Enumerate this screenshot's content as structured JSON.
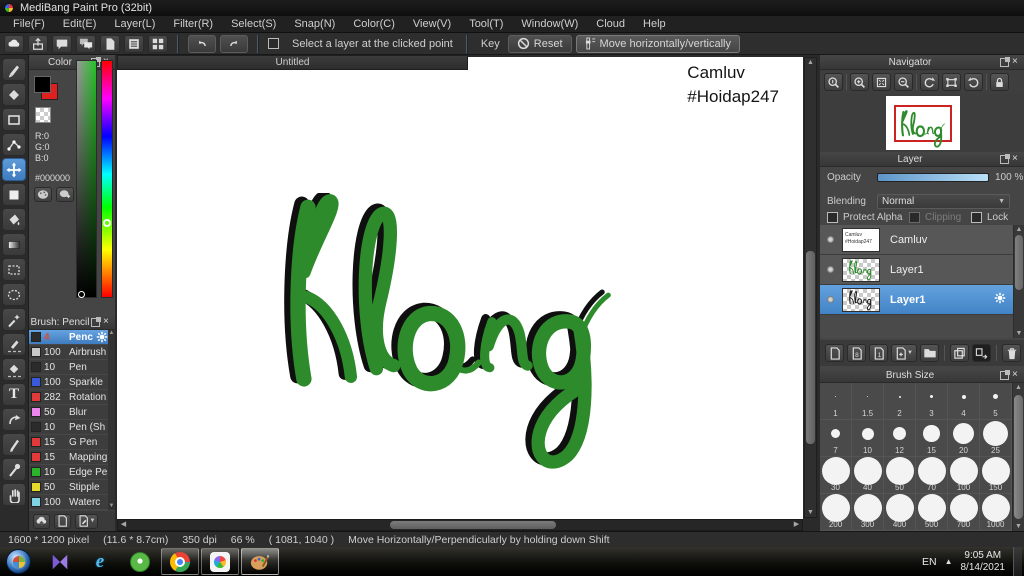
{
  "window": {
    "title": "MediBang Paint Pro (32bit)"
  },
  "menu": {
    "items": [
      "File(F)",
      "Edit(E)",
      "Layer(L)",
      "Filter(R)",
      "Select(S)",
      "Snap(N)",
      "Color(C)",
      "View(V)",
      "Tool(T)",
      "Window(W)",
      "Cloud",
      "Help"
    ]
  },
  "toolbar": {
    "select_layer_label": "Select a layer at the clicked point",
    "key_label": "Key",
    "reset_label": "Reset",
    "move_label": "Move horizontally/vertically"
  },
  "color_panel": {
    "title": "Color",
    "r": "R:0",
    "g": "G:0",
    "b": "B:0",
    "hex": "#000000"
  },
  "brush_panel": {
    "title": "Brush: Pencil",
    "brushes": [
      {
        "size": "4",
        "name": "Pencil",
        "swatch": "#2b2b2b",
        "selected": true
      },
      {
        "size": "100",
        "name": "Airbrush",
        "swatch": "#c8c8c8",
        "selected": false
      },
      {
        "size": "10",
        "name": "Pen",
        "swatch": "#2b2b2b",
        "selected": false
      },
      {
        "size": "100",
        "name": "Sparkle",
        "swatch": "#3a5bd9",
        "selected": false
      },
      {
        "size": "282",
        "name": "Rotation",
        "swatch": "#e03a3a",
        "selected": false
      },
      {
        "size": "50",
        "name": "Blur",
        "swatch": "#ec86ec",
        "selected": false
      },
      {
        "size": "10",
        "name": "Pen (Sh",
        "swatch": "#2b2b2b",
        "selected": false
      },
      {
        "size": "15",
        "name": "G Pen",
        "swatch": "#e03a3a",
        "selected": false
      },
      {
        "size": "15",
        "name": "Mapping",
        "swatch": "#e03a3a",
        "selected": false
      },
      {
        "size": "10",
        "name": "Edge Pe",
        "swatch": "#2bb32b",
        "selected": false
      },
      {
        "size": "50",
        "name": "Stipple",
        "swatch": "#e6d92b",
        "selected": false
      },
      {
        "size": "100",
        "name": "Waterc",
        "swatch": "#7fd4e8",
        "selected": false
      }
    ]
  },
  "canvas": {
    "tab": "Untitled",
    "annotation_line1": "Camluv",
    "annotation_line2": "#Hoidap247",
    "word": "Klong",
    "ink_color": "#2e8b2c"
  },
  "navigator": {
    "title": "Navigator"
  },
  "layer_panel": {
    "title": "Layer",
    "opacity_label": "Opacity",
    "opacity_value": "100 %",
    "blending_label": "Blending",
    "blending_value": "Normal",
    "protect_alpha_label": "Protect Alpha",
    "clipping_label": "Clipping",
    "lock_label": "Lock",
    "layers": [
      {
        "name": "Camluv",
        "thumb": "text",
        "selected": false
      },
      {
        "name": "Layer1",
        "thumb": "ink-green",
        "selected": false
      },
      {
        "name": "Layer1",
        "thumb": "ink-dark",
        "selected": true
      }
    ]
  },
  "brush_size_panel": {
    "title": "Brush Size",
    "sizes": [
      "1",
      "1.5",
      "2",
      "3",
      "4",
      "5",
      "7",
      "10",
      "12",
      "15",
      "20",
      "25",
      "30",
      "40",
      "50",
      "70",
      "100",
      "150",
      "200",
      "300",
      "400",
      "500",
      "700",
      "1000"
    ]
  },
  "status_bar": {
    "size": "1600 * 1200 pixel",
    "cm": "(11.6 * 8.7cm)",
    "dpi": "350 dpi",
    "zoom": "66 %",
    "coords": "( 1081, 1040 )",
    "hint": "Move Horizontally/Perpendicularly by holding down Shift"
  },
  "taskbar": {
    "language": "EN",
    "time": "9:05 AM",
    "date": "8/14/2021"
  },
  "colors": {
    "accent_blue": "#4183c6",
    "ink_green": "#2e8b2c",
    "nav_rect_red": "#cc2222"
  }
}
